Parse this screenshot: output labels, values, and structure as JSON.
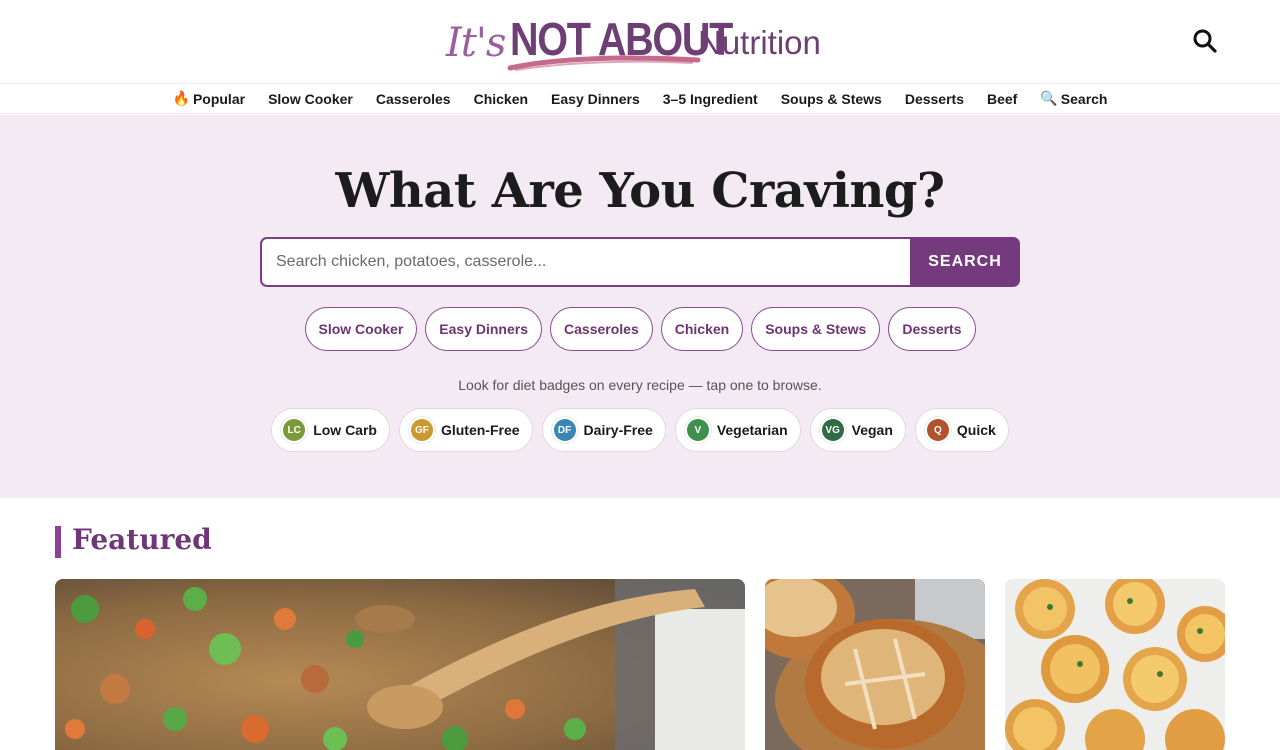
{
  "logo": {
    "its": "It's",
    "not_about": "NOT ABOUT",
    "nutrition": "Nutrition"
  },
  "header": {
    "search_icon": "search-icon"
  },
  "nav": {
    "items": [
      {
        "label": "Popular",
        "icon": "🔥"
      },
      {
        "label": "Slow Cooker"
      },
      {
        "label": "Casseroles"
      },
      {
        "label": "Chicken"
      },
      {
        "label": "Easy Dinners"
      },
      {
        "label": "3–5 Ingredient"
      },
      {
        "label": "Soups & Stews"
      },
      {
        "label": "Desserts"
      },
      {
        "label": "Beef"
      },
      {
        "label": "Search",
        "icon": "🔍"
      }
    ]
  },
  "hero": {
    "title": "What Are You Craving?",
    "search_placeholder": "Search chicken, potatoes, casserole...",
    "search_button": "SEARCH",
    "categories": [
      "Slow Cooker",
      "Easy Dinners",
      "Casseroles",
      "Chicken",
      "Soups & Stews",
      "Desserts"
    ],
    "diet_note": "Look for diet badges on every recipe — tap one to browse.",
    "diets": [
      {
        "badge": "LC",
        "label": "Low Carb",
        "color": "#7a9a3a"
      },
      {
        "badge": "GF",
        "label": "Gluten-Free",
        "color": "#c99a2e"
      },
      {
        "badge": "DF",
        "label": "Dairy-Free",
        "color": "#3a86b4"
      },
      {
        "badge": "V",
        "label": "Vegetarian",
        "color": "#3f8f4f"
      },
      {
        "badge": "VG",
        "label": "Vegan",
        "color": "#2f6b45"
      },
      {
        "badge": "Q",
        "label": "Quick",
        "color": "#b0532e"
      }
    ]
  },
  "featured": {
    "title": "Featured"
  },
  "colors": {
    "brand": "#743a7d",
    "hero_bg": "#f3eaf3"
  }
}
